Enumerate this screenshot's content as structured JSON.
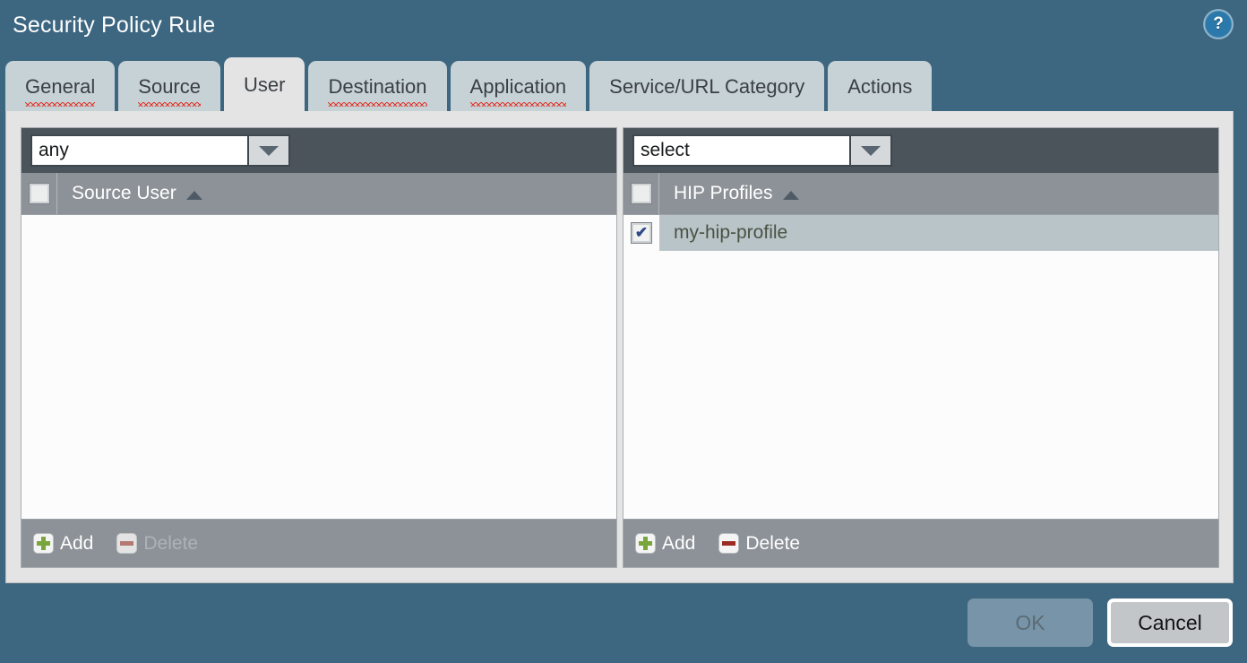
{
  "dialog": {
    "title": "Security Policy Rule",
    "help_icon": "help-question-icon",
    "help_glyph": "?"
  },
  "tabs": [
    {
      "label": "General",
      "active": false,
      "misspelled": true
    },
    {
      "label": "Source",
      "active": false,
      "misspelled": true
    },
    {
      "label": "User",
      "active": true,
      "misspelled": false
    },
    {
      "label": "Destination",
      "active": false,
      "misspelled": true
    },
    {
      "label": "Application",
      "active": false,
      "misspelled": true
    },
    {
      "label": "Service/URL Category",
      "active": false,
      "misspelled": false
    },
    {
      "label": "Actions",
      "active": false,
      "misspelled": false
    }
  ],
  "panels": {
    "source_user": {
      "combo_value": "any",
      "combo_placeholder": "any",
      "column_header": "Source User",
      "sort_direction": "ascending",
      "header_checkbox_checked": false,
      "rows": [],
      "footer": {
        "add_label": "Add",
        "add_enabled": true,
        "delete_label": "Delete",
        "delete_enabled": false
      }
    },
    "hip_profiles": {
      "combo_value": "select",
      "combo_placeholder": "select",
      "column_header": "HIP Profiles",
      "sort_direction": "ascending",
      "header_checkbox_checked": false,
      "rows": [
        {
          "label": "my-hip-profile",
          "checked": true,
          "selected": true
        }
      ],
      "footer": {
        "add_label": "Add",
        "add_enabled": true,
        "delete_label": "Delete",
        "delete_enabled": true
      }
    }
  },
  "buttons": {
    "ok_label": "OK",
    "ok_enabled": false,
    "cancel_label": "Cancel",
    "cancel_enabled": true
  },
  "colors": {
    "dialog_background": "#3d6680",
    "content_background": "#e4e4e4",
    "tab_inactive": "#c6d2d6",
    "tab_active": "#e4e4e4",
    "toolbar_dark": "#4b535b",
    "header_gray": "#8d9298",
    "row_selected": "#b8c4c7",
    "add_green": "#79a63c",
    "delete_red": "#9c2b24",
    "spellcheck_red": "#e03a30"
  },
  "checkmark_glyph": "✔"
}
